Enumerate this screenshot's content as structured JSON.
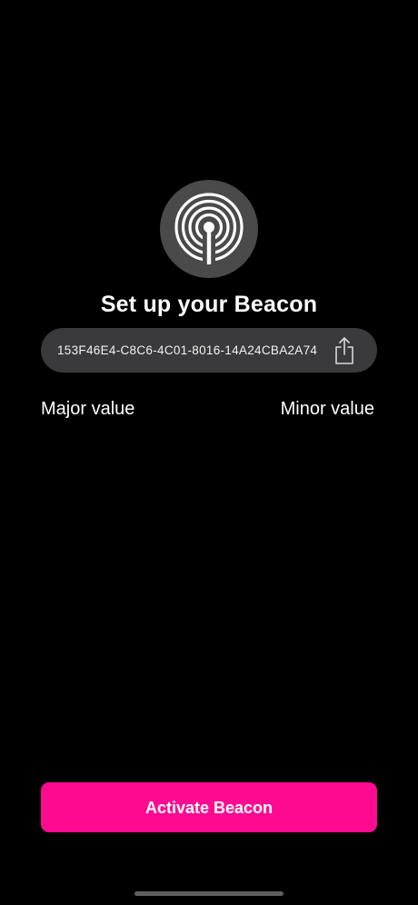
{
  "header": {
    "icon": "beacon-broadcast-icon",
    "title": "Set up your Beacon"
  },
  "uuid": {
    "value": "153F46E4-C8C6-4C01-8016-14A24CBA2A74",
    "share_icon": "share-icon"
  },
  "values": {
    "major_label": "Major value",
    "minor_label": "Minor value"
  },
  "actions": {
    "activate_label": "Activate Beacon"
  },
  "colors": {
    "background": "#000000",
    "accent": "#ff0a91",
    "pill": "#3a3a3c",
    "icon_badge": "#4a4a4a"
  }
}
